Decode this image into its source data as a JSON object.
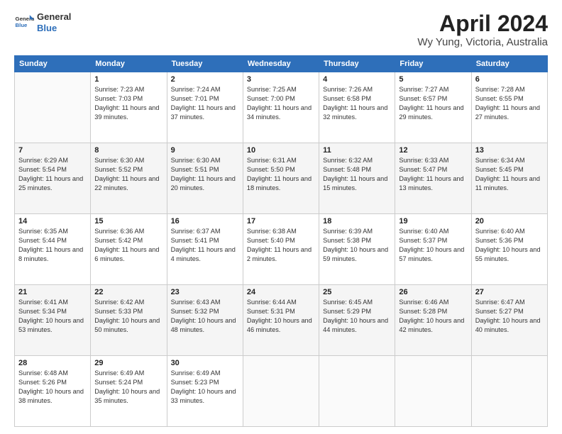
{
  "header": {
    "logo_line1": "General",
    "logo_line2": "Blue",
    "month": "April 2024",
    "location": "Wy Yung, Victoria, Australia"
  },
  "weekdays": [
    "Sunday",
    "Monday",
    "Tuesday",
    "Wednesday",
    "Thursday",
    "Friday",
    "Saturday"
  ],
  "weeks": [
    [
      {
        "day": "",
        "sunrise": "",
        "sunset": "",
        "daylight": ""
      },
      {
        "day": "1",
        "sunrise": "Sunrise: 7:23 AM",
        "sunset": "Sunset: 7:03 PM",
        "daylight": "Daylight: 11 hours and 39 minutes."
      },
      {
        "day": "2",
        "sunrise": "Sunrise: 7:24 AM",
        "sunset": "Sunset: 7:01 PM",
        "daylight": "Daylight: 11 hours and 37 minutes."
      },
      {
        "day": "3",
        "sunrise": "Sunrise: 7:25 AM",
        "sunset": "Sunset: 7:00 PM",
        "daylight": "Daylight: 11 hours and 34 minutes."
      },
      {
        "day": "4",
        "sunrise": "Sunrise: 7:26 AM",
        "sunset": "Sunset: 6:58 PM",
        "daylight": "Daylight: 11 hours and 32 minutes."
      },
      {
        "day": "5",
        "sunrise": "Sunrise: 7:27 AM",
        "sunset": "Sunset: 6:57 PM",
        "daylight": "Daylight: 11 hours and 29 minutes."
      },
      {
        "day": "6",
        "sunrise": "Sunrise: 7:28 AM",
        "sunset": "Sunset: 6:55 PM",
        "daylight": "Daylight: 11 hours and 27 minutes."
      }
    ],
    [
      {
        "day": "7",
        "sunrise": "Sunrise: 6:29 AM",
        "sunset": "Sunset: 5:54 PM",
        "daylight": "Daylight: 11 hours and 25 minutes."
      },
      {
        "day": "8",
        "sunrise": "Sunrise: 6:30 AM",
        "sunset": "Sunset: 5:52 PM",
        "daylight": "Daylight: 11 hours and 22 minutes."
      },
      {
        "day": "9",
        "sunrise": "Sunrise: 6:30 AM",
        "sunset": "Sunset: 5:51 PM",
        "daylight": "Daylight: 11 hours and 20 minutes."
      },
      {
        "day": "10",
        "sunrise": "Sunrise: 6:31 AM",
        "sunset": "Sunset: 5:50 PM",
        "daylight": "Daylight: 11 hours and 18 minutes."
      },
      {
        "day": "11",
        "sunrise": "Sunrise: 6:32 AM",
        "sunset": "Sunset: 5:48 PM",
        "daylight": "Daylight: 11 hours and 15 minutes."
      },
      {
        "day": "12",
        "sunrise": "Sunrise: 6:33 AM",
        "sunset": "Sunset: 5:47 PM",
        "daylight": "Daylight: 11 hours and 13 minutes."
      },
      {
        "day": "13",
        "sunrise": "Sunrise: 6:34 AM",
        "sunset": "Sunset: 5:45 PM",
        "daylight": "Daylight: 11 hours and 11 minutes."
      }
    ],
    [
      {
        "day": "14",
        "sunrise": "Sunrise: 6:35 AM",
        "sunset": "Sunset: 5:44 PM",
        "daylight": "Daylight: 11 hours and 8 minutes."
      },
      {
        "day": "15",
        "sunrise": "Sunrise: 6:36 AM",
        "sunset": "Sunset: 5:42 PM",
        "daylight": "Daylight: 11 hours and 6 minutes."
      },
      {
        "day": "16",
        "sunrise": "Sunrise: 6:37 AM",
        "sunset": "Sunset: 5:41 PM",
        "daylight": "Daylight: 11 hours and 4 minutes."
      },
      {
        "day": "17",
        "sunrise": "Sunrise: 6:38 AM",
        "sunset": "Sunset: 5:40 PM",
        "daylight": "Daylight: 11 hours and 2 minutes."
      },
      {
        "day": "18",
        "sunrise": "Sunrise: 6:39 AM",
        "sunset": "Sunset: 5:38 PM",
        "daylight": "Daylight: 10 hours and 59 minutes."
      },
      {
        "day": "19",
        "sunrise": "Sunrise: 6:40 AM",
        "sunset": "Sunset: 5:37 PM",
        "daylight": "Daylight: 10 hours and 57 minutes."
      },
      {
        "day": "20",
        "sunrise": "Sunrise: 6:40 AM",
        "sunset": "Sunset: 5:36 PM",
        "daylight": "Daylight: 10 hours and 55 minutes."
      }
    ],
    [
      {
        "day": "21",
        "sunrise": "Sunrise: 6:41 AM",
        "sunset": "Sunset: 5:34 PM",
        "daylight": "Daylight: 10 hours and 53 minutes."
      },
      {
        "day": "22",
        "sunrise": "Sunrise: 6:42 AM",
        "sunset": "Sunset: 5:33 PM",
        "daylight": "Daylight: 10 hours and 50 minutes."
      },
      {
        "day": "23",
        "sunrise": "Sunrise: 6:43 AM",
        "sunset": "Sunset: 5:32 PM",
        "daylight": "Daylight: 10 hours and 48 minutes."
      },
      {
        "day": "24",
        "sunrise": "Sunrise: 6:44 AM",
        "sunset": "Sunset: 5:31 PM",
        "daylight": "Daylight: 10 hours and 46 minutes."
      },
      {
        "day": "25",
        "sunrise": "Sunrise: 6:45 AM",
        "sunset": "Sunset: 5:29 PM",
        "daylight": "Daylight: 10 hours and 44 minutes."
      },
      {
        "day": "26",
        "sunrise": "Sunrise: 6:46 AM",
        "sunset": "Sunset: 5:28 PM",
        "daylight": "Daylight: 10 hours and 42 minutes."
      },
      {
        "day": "27",
        "sunrise": "Sunrise: 6:47 AM",
        "sunset": "Sunset: 5:27 PM",
        "daylight": "Daylight: 10 hours and 40 minutes."
      }
    ],
    [
      {
        "day": "28",
        "sunrise": "Sunrise: 6:48 AM",
        "sunset": "Sunset: 5:26 PM",
        "daylight": "Daylight: 10 hours and 38 minutes."
      },
      {
        "day": "29",
        "sunrise": "Sunrise: 6:49 AM",
        "sunset": "Sunset: 5:24 PM",
        "daylight": "Daylight: 10 hours and 35 minutes."
      },
      {
        "day": "30",
        "sunrise": "Sunrise: 6:49 AM",
        "sunset": "Sunset: 5:23 PM",
        "daylight": "Daylight: 10 hours and 33 minutes."
      },
      {
        "day": "",
        "sunrise": "",
        "sunset": "",
        "daylight": ""
      },
      {
        "day": "",
        "sunrise": "",
        "sunset": "",
        "daylight": ""
      },
      {
        "day": "",
        "sunrise": "",
        "sunset": "",
        "daylight": ""
      },
      {
        "day": "",
        "sunrise": "",
        "sunset": "",
        "daylight": ""
      }
    ]
  ]
}
